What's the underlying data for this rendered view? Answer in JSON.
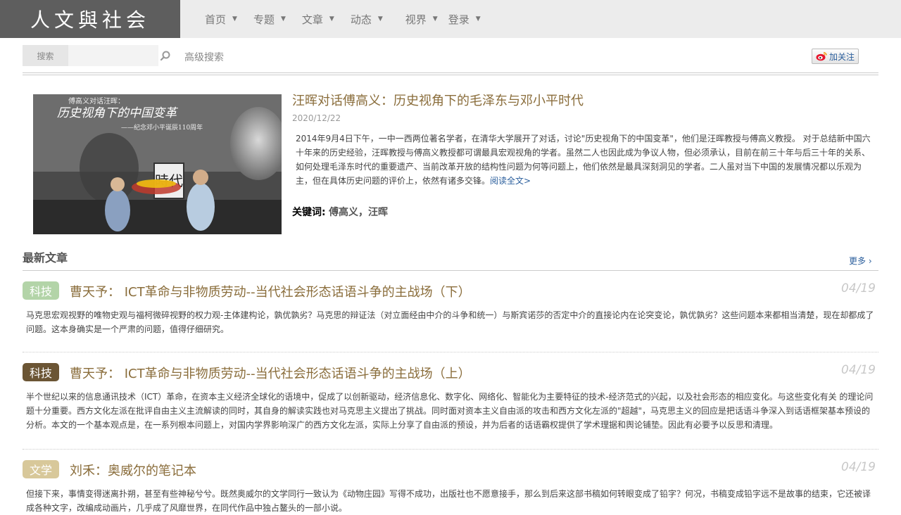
{
  "header": {
    "logo": "人文與社会",
    "nav": [
      {
        "label": "首页"
      },
      {
        "label": "专题"
      },
      {
        "label": "文章"
      },
      {
        "label": "动态"
      },
      {
        "label": "视界"
      },
      {
        "label": "登录"
      }
    ]
  },
  "search": {
    "label": "搜索",
    "value": "",
    "placeholder": "",
    "advanced": "高级搜索"
  },
  "follow": {
    "label": "加关注"
  },
  "feature": {
    "title": "汪晖对话傅高义：历史视角下的毛泽东与邓小平时代",
    "date": "2020/12/22",
    "summary": "2014年9月4日下午，一中一西两位著名学者，在清华大学展开了对话，讨论\"历史视角下的中国变革\"，他们是汪晖教授与傅高义教授。 对于总结新中国六十年来的历史经验，汪晖教授与傅高义教授都可谓最具宏观视角的学者。虽然二人也因此成为争议人物，但必须承认，目前在前三十年与后三十年的关系、如何处理毛泽东时代的重要遗产、当前改革开放的结构性问题为何等问题上，他们依然是最具深刻洞见的学者。二人虽对当下中国的发展情况都以乐观为主，但在具体历史问题的评价上，依然有诸多交锋。",
    "read_more": "阅读全文>",
    "keywords_label": "关键词:",
    "keywords": "傅高义，汪晖",
    "image": {
      "banner_line1": "傅高义对话汪晖：",
      "banner_line2": "历史视角下的中国变革",
      "banner_line3": "——纪念邓小平诞辰110周年",
      "stamp": "時代"
    }
  },
  "latest": {
    "title": "最新文章",
    "more": "更多",
    "articles": [
      {
        "tag": "科技",
        "tag_color": "#b3d4a8",
        "title": "曹天予： ICT革命与非物质劳动--当代社会形态话语斗争的主战场（下）",
        "date": "04/19",
        "summary": "马克思宏观视野的唯物史观与福柯微碎视野的权力观-主体建构论，孰优孰劣？马克思的辩证法（对立面经由中介的斗争和统一）与斯宾诺莎的否定中介的直接论内在论突变论，孰优孰劣？这些问题本来都相当清楚，现在却都成了问题。这本身确实是一个严肃的问题，值得仔细研究。"
      },
      {
        "tag": "科技",
        "tag_color": "#6b5534",
        "title": "曹天予： ICT革命与非物质劳动--当代社会形态话语斗争的主战场（上）",
        "date": "04/19",
        "summary": "半个世纪以来的信息通讯技术（ICT）革命，在资本主义经济全球化的语境中，促成了以创新驱动，经济信息化、数字化、网络化、智能化为主要特征的技术-经济范式的兴起，以及社会形态的相应变化。与这些变化有关 的理论问题十分重要。西方文化左派在批评自由主义主流解读的同时，其自身的解读实践也对马克思主义提出了挑战。同时面对资本主义自由派的攻击和西方文化左派的\"超越\"，马克思主义的回应是把话语斗争深入到话语框架基本预设的分析。本文的一个基本观点是，在一系列根本问题上，对国内学界影响深广的西方文化左派，实际上分享了自由派的预设，并为后者的话语霸权提供了学术理据和舆论铺垫。因此有必要予以反思和清理。"
      },
      {
        "tag": "文学",
        "tag_color": "#d8c89a",
        "title": "刘禾：奥威尔的笔记本",
        "date": "04/19",
        "summary": "但接下来，事情变得迷离扑朔，甚至有些神秘兮兮。既然奥威尔的文学同行一致认为《动物庄园》写得不成功，出版社也不愿意接手，那么到后来这部书稿如何转眼变成了铅字？何况，书稿变成铅字远不是故事的结束，它还被译成各种文字，改编成动画片，几乎成了风靡世界，在同代作品中独占鳌头的一部小说。"
      }
    ]
  }
}
